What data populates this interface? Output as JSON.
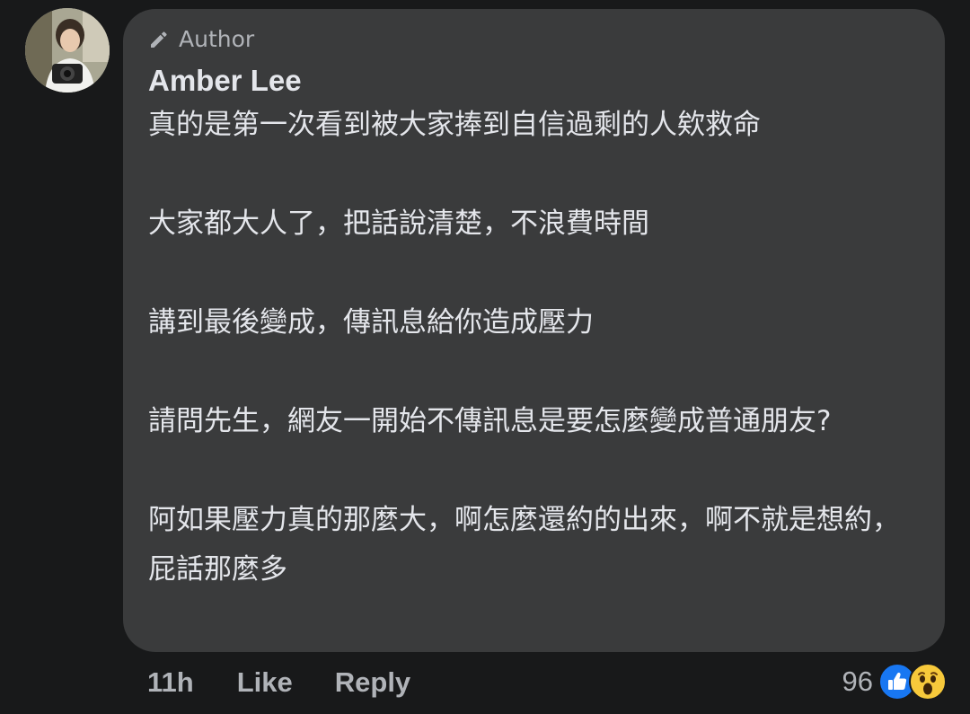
{
  "comment": {
    "badge_label": "Author",
    "badge_icon": "pencil-icon",
    "author_name": "Amber Lee",
    "paragraphs": [
      "真的是第一次看到被大家捧到自信過剩的人欸救命",
      "大家都大人了，把話說清楚，不浪費時間",
      "講到最後變成，傳訊息給你造成壓力",
      "請問先生，網友一開始不傳訊息是要怎麼變成普通朋友?",
      "阿如果壓力真的那麼大，啊怎麼還約的出來，啊不就是想約，屁話那麼多"
    ]
  },
  "actions": {
    "time": "11h",
    "like_label": "Like",
    "reply_label": "Reply"
  },
  "reactions": {
    "count": "96",
    "icons": [
      "like-icon",
      "wow-icon"
    ]
  },
  "colors": {
    "background": "#18191a",
    "bubble": "#3a3b3c",
    "text_primary": "#e4e6eb",
    "text_secondary": "#b0b3b8",
    "like_blue": "#1877f2",
    "wow_yellow": "#f7c93b"
  }
}
